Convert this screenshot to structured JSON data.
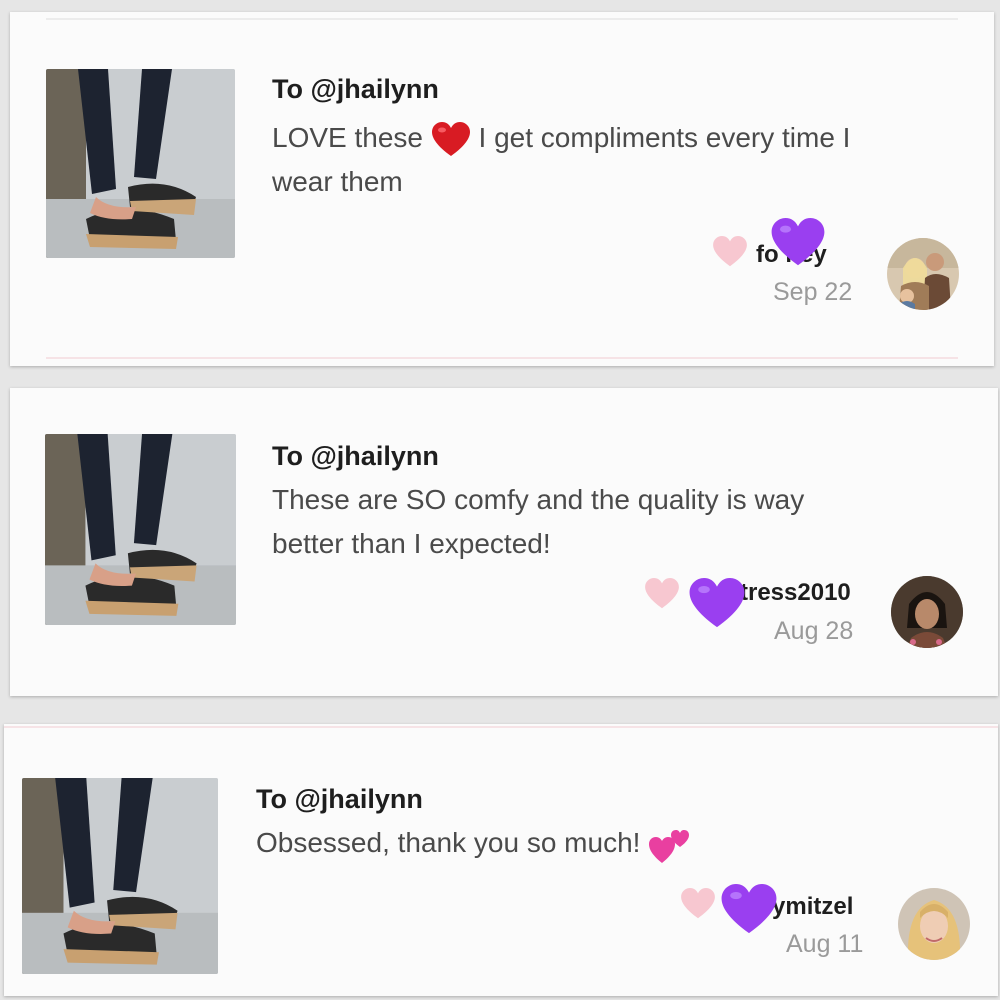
{
  "reviews": [
    {
      "to": "To @jhailynn",
      "message_before": "LOVE these",
      "message_after": "I get compliments every time I",
      "message_line2": "wear them",
      "inline_emoji": "red-heart-icon",
      "username": "fo   ifey",
      "date": "Sep 22"
    },
    {
      "to": "To @jhailynn",
      "message_line1": "These are SO comfy and the quality is way",
      "message_line2": "better than I expected!",
      "username": "tress2010",
      "date": "Aug 28"
    },
    {
      "to": "To @jhailynn",
      "message_before": "Obsessed, thank you so much!",
      "inline_emoji": "two-hearts-icon",
      "username": "ymitzel",
      "date": "Aug 11"
    }
  ],
  "colors": {
    "pink_heart": "#f7c7d0",
    "purple_heart": "#9a3ff0",
    "red_heart": "#d81b23",
    "magenta_hearts": "#e93fa0"
  }
}
